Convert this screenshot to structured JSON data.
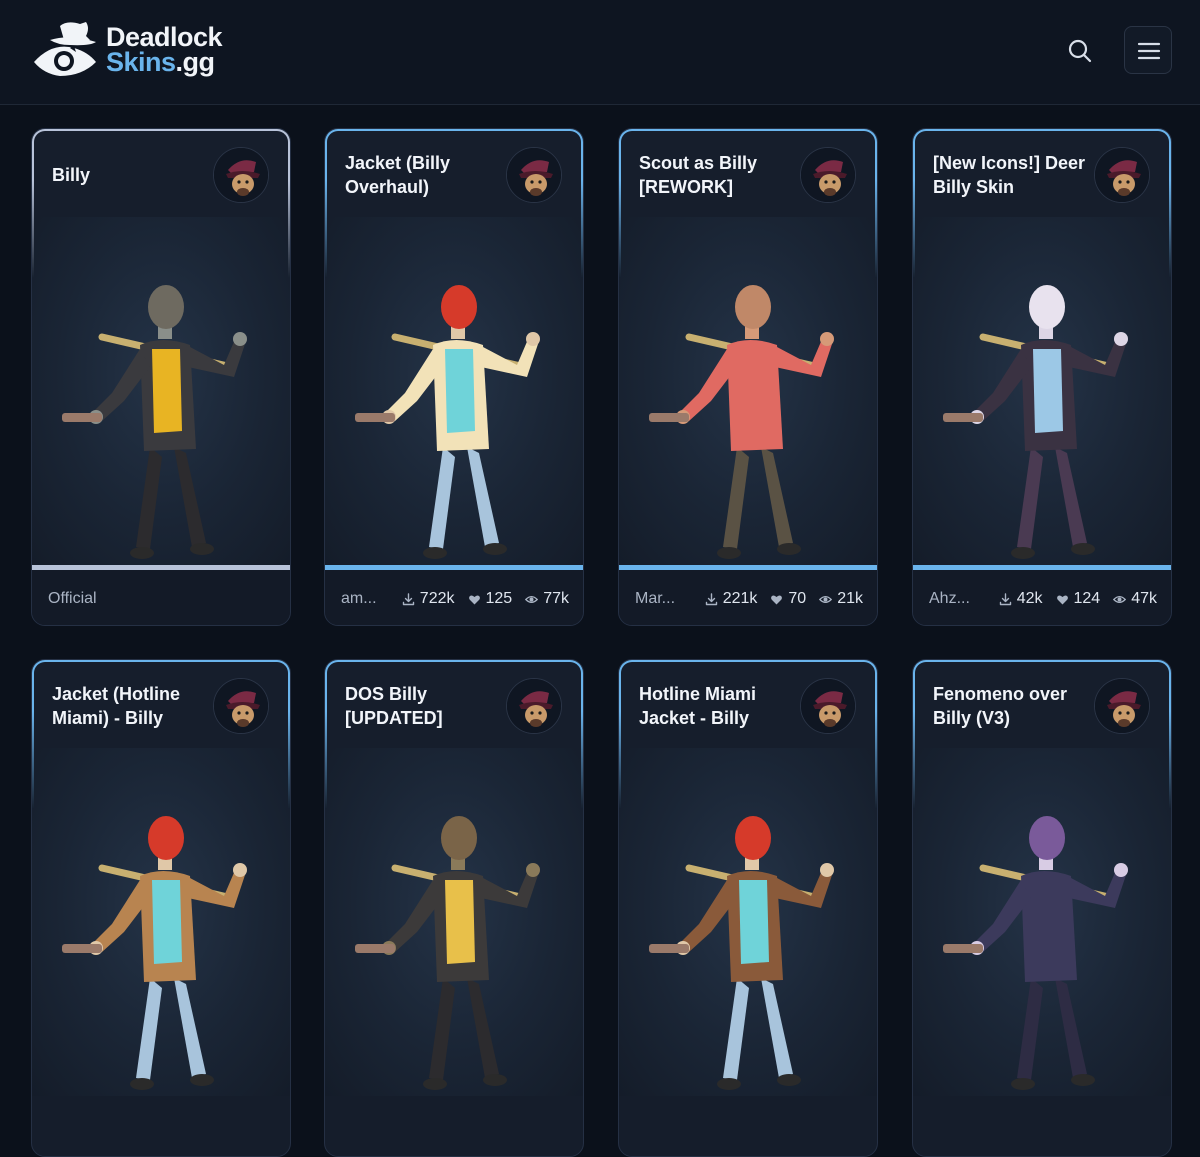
{
  "header": {
    "logo_line1": "Deadlock",
    "logo_line2a": "Skins",
    "logo_line2b": ".gg",
    "search_icon": "search-icon",
    "menu_icon": "hamburger-menu-icon"
  },
  "cards": [
    {
      "title": "Billy",
      "author": "Official",
      "official": true,
      "accent": "#b8c3d9"
    },
    {
      "title": "Jacket (Billy Overhaul)",
      "author": "am...",
      "downloads": "722k",
      "likes": "125",
      "views": "77k",
      "slides": 3,
      "active_slide": 0
    },
    {
      "title": "Scout as Billy [REWORK]",
      "author": "Mar...",
      "downloads": "221k",
      "likes": "70",
      "views": "21k",
      "slides": 7,
      "active_slide": 0
    },
    {
      "title": "[New Icons!] Deer Billy Skin",
      "author": "Ahz...",
      "downloads": "42k",
      "likes": "124",
      "views": "47k",
      "slides": 6,
      "active_slide": 0
    },
    {
      "title": "Jacket (Hotline Miami) - Billy"
    },
    {
      "title": "DOS Billy [UPDATED]"
    },
    {
      "title": "Hotline Miami Jacket - Billy"
    },
    {
      "title": "Fenomeno over Billy (V3)"
    }
  ],
  "colors": {
    "accent": "#6ab4ec",
    "background": "#0b111b",
    "card": "#151d2b"
  }
}
